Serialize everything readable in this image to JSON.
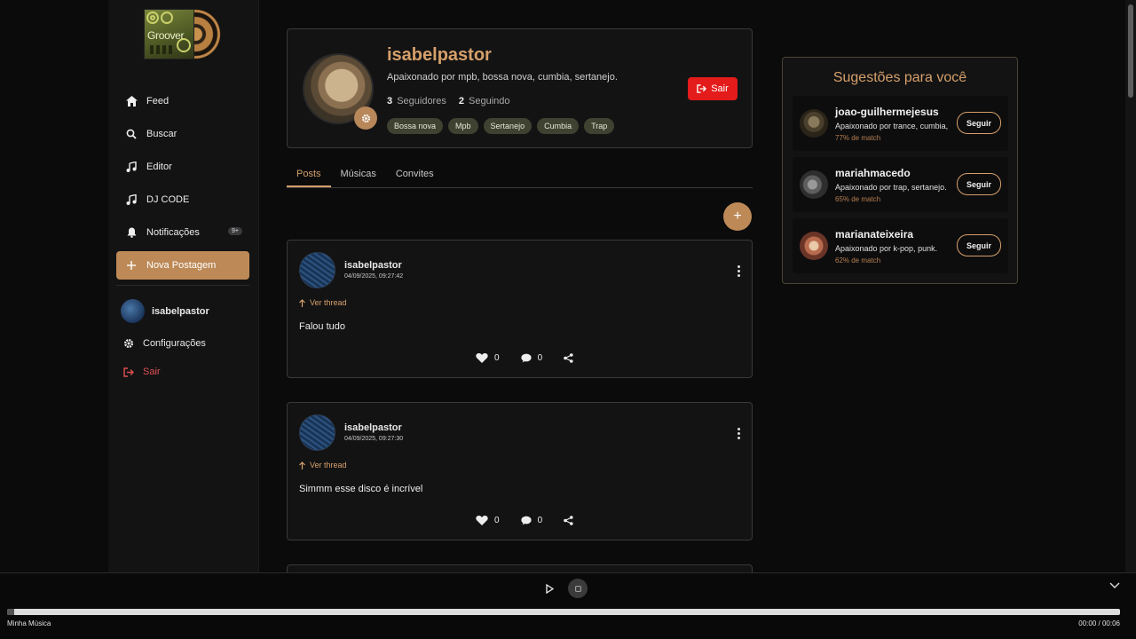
{
  "brand": {
    "logo_text": "Groover"
  },
  "sidebar": {
    "items": [
      {
        "label": "Feed",
        "icon": "home-icon"
      },
      {
        "label": "Buscar",
        "icon": "search-icon"
      },
      {
        "label": "Editor",
        "icon": "music-note-icon"
      },
      {
        "label": "DJ CODE",
        "icon": "music-note-icon"
      },
      {
        "label": "Notificações",
        "icon": "bell-icon",
        "badge": "9+"
      },
      {
        "label": "Nova Postagem",
        "icon": "plus-icon"
      }
    ],
    "user": {
      "name": "isabelpastor"
    },
    "settings_label": "Configurações",
    "logout_label": "Sair"
  },
  "profile": {
    "username": "isabelpastor",
    "bio": "Apaixonado por mpb, bossa nova, cumbia, sertanejo.",
    "followers_count": "3",
    "followers_label": "Seguidores",
    "following_count": "2",
    "following_label": "Seguindo",
    "tags": [
      "Bossa nova",
      "Mpb",
      "Sertanejo",
      "Cumbia",
      "Trap"
    ],
    "logout_label": "Sair"
  },
  "tabs": [
    {
      "label": "Posts",
      "active": true
    },
    {
      "label": "Músicas",
      "active": false
    },
    {
      "label": "Convites",
      "active": false
    }
  ],
  "fab_label": "+",
  "posts": [
    {
      "author": "isabelpastor",
      "date": "04/09/2025, 09:27:42",
      "thread_label": "Ver thread",
      "content": "Falou tudo",
      "likes": "0",
      "comments": "0"
    },
    {
      "author": "isabelpastor",
      "date": "04/09/2025, 09:27:30",
      "thread_label": "Ver thread",
      "content": "Simmm esse disco é incrível",
      "likes": "0",
      "comments": "0"
    }
  ],
  "suggestions": {
    "title": "Sugestões para você",
    "items": [
      {
        "name": "joao-guilhermejesus",
        "bio": "Apaixonado por trance, cumbia,",
        "match": "77% de match",
        "follow_label": "Seguir"
      },
      {
        "name": "mariahmacedo",
        "bio": "Apaixonado por trap, sertanejo.",
        "match": "65% de match",
        "follow_label": "Seguir"
      },
      {
        "name": "marianateixeira",
        "bio": "Apaixonado por k-pop, punk.",
        "match": "62% de match",
        "follow_label": "Seguir"
      }
    ]
  },
  "player": {
    "track_title": "Minha Música",
    "time": "00:00 / 00:06",
    "progress": 0.006
  },
  "colors": {
    "accent": "#bd8956",
    "accent_text": "#d6a06a",
    "danger": "#e41b1b",
    "background": "#0b0b0c",
    "card": "#131314"
  }
}
